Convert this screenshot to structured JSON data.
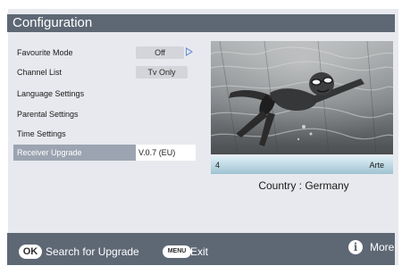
{
  "window": {
    "title": "Configuration"
  },
  "menu": {
    "items": [
      {
        "label": "Favourite Mode",
        "value": "Off",
        "has_arrow": true,
        "selected": false
      },
      {
        "label": "Channel List",
        "value": "Tv Only",
        "has_arrow": false,
        "selected": false
      },
      {
        "label": "Language Settings",
        "value": "",
        "has_arrow": false,
        "selected": false
      },
      {
        "label": "Parental Settings",
        "value": "",
        "has_arrow": false,
        "selected": false
      },
      {
        "label": "Time Settings",
        "value": "",
        "has_arrow": false,
        "selected": false
      },
      {
        "label": "Receiver Upgrade",
        "value": "V.0.7 (EU)",
        "has_arrow": false,
        "selected": true
      }
    ]
  },
  "preview": {
    "channel_number": "4",
    "channel_name": "Arte",
    "country_line": "Country : Germany"
  },
  "footer": {
    "ok_key": "OK",
    "ok_action": "Search for Upgrade",
    "menu_key": "MENU",
    "menu_action": "Exit",
    "info_icon_glyph": "i",
    "info_action": "More"
  },
  "colors": {
    "header_bg": "#5e6875",
    "panel_bg": "#e7e9ee",
    "selected_row_bg": "#9ba4b0",
    "arrow_accent": "#6b8fd6",
    "channel_bar_top": "#dff0f6",
    "channel_bar_bottom": "#9fc2d1"
  }
}
